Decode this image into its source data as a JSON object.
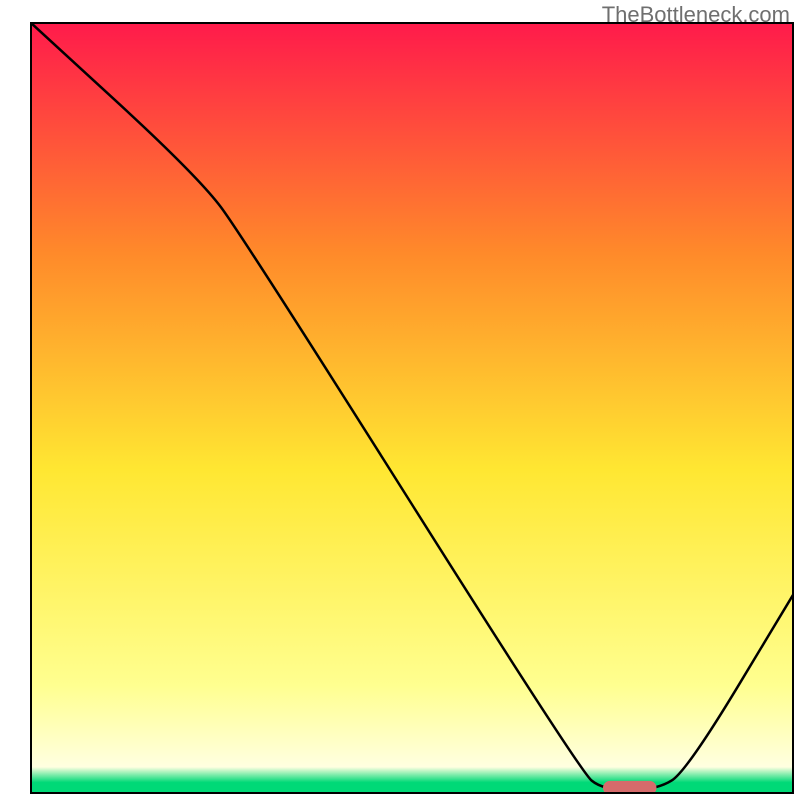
{
  "watermark": "TheBottleneck.com",
  "chart_data": {
    "type": "line",
    "title": "",
    "xlabel": "",
    "ylabel": "",
    "xlim": [
      0,
      100
    ],
    "ylim": [
      0,
      100
    ],
    "grid": false,
    "curve": [
      {
        "x": 0,
        "y": 100
      },
      {
        "x": 22,
        "y": 80
      },
      {
        "x": 28,
        "y": 72
      },
      {
        "x": 72,
        "y": 3
      },
      {
        "x": 75,
        "y": 0.5
      },
      {
        "x": 82,
        "y": 0.5
      },
      {
        "x": 86,
        "y": 3
      },
      {
        "x": 100,
        "y": 26
      }
    ],
    "minimum_marker": {
      "x_start": 75,
      "x_end": 82,
      "y": 0.8,
      "color": "#d66b6b"
    },
    "background_gradient": {
      "top": "#ff1a4b",
      "upper_mid": "#ff8a2a",
      "mid": "#ffe732",
      "lower_mid": "#ffff90",
      "bottom": "#00d977"
    }
  }
}
